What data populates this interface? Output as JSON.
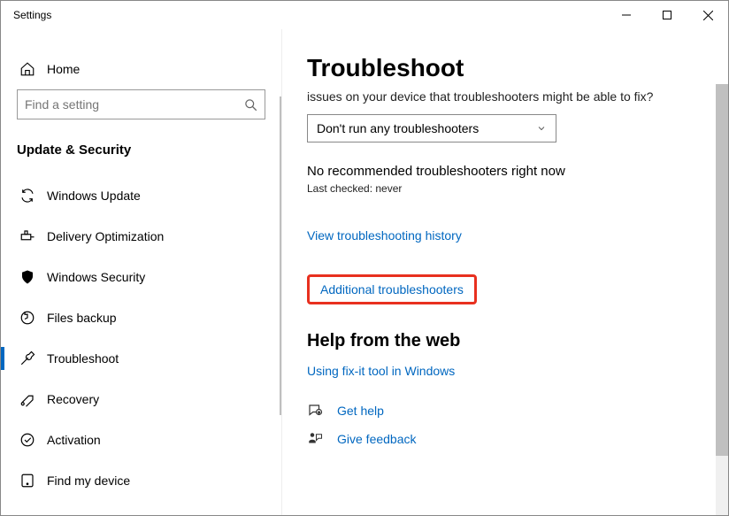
{
  "window": {
    "title": "Settings"
  },
  "sidebar": {
    "home": "Home",
    "search_placeholder": "Find a setting",
    "section": "Update & Security",
    "items": [
      {
        "label": "Windows Update"
      },
      {
        "label": "Delivery Optimization"
      },
      {
        "label": "Windows Security"
      },
      {
        "label": "Files backup"
      },
      {
        "label": "Troubleshoot"
      },
      {
        "label": "Recovery"
      },
      {
        "label": "Activation"
      },
      {
        "label": "Find my device"
      }
    ]
  },
  "main": {
    "title": "Troubleshoot",
    "intro_tail": "issues on your device that troubleshooters might be able to fix?",
    "select_value": "Don't run any troubleshooters",
    "status": "No recommended troubleshooters right now",
    "last_checked_label": "Last checked: never",
    "view_history": "View troubleshooting history",
    "additional": "Additional troubleshooters",
    "help_header": "Help from the web",
    "help_link": "Using fix-it tool in Windows",
    "get_help": "Get help",
    "give_feedback": "Give feedback"
  }
}
